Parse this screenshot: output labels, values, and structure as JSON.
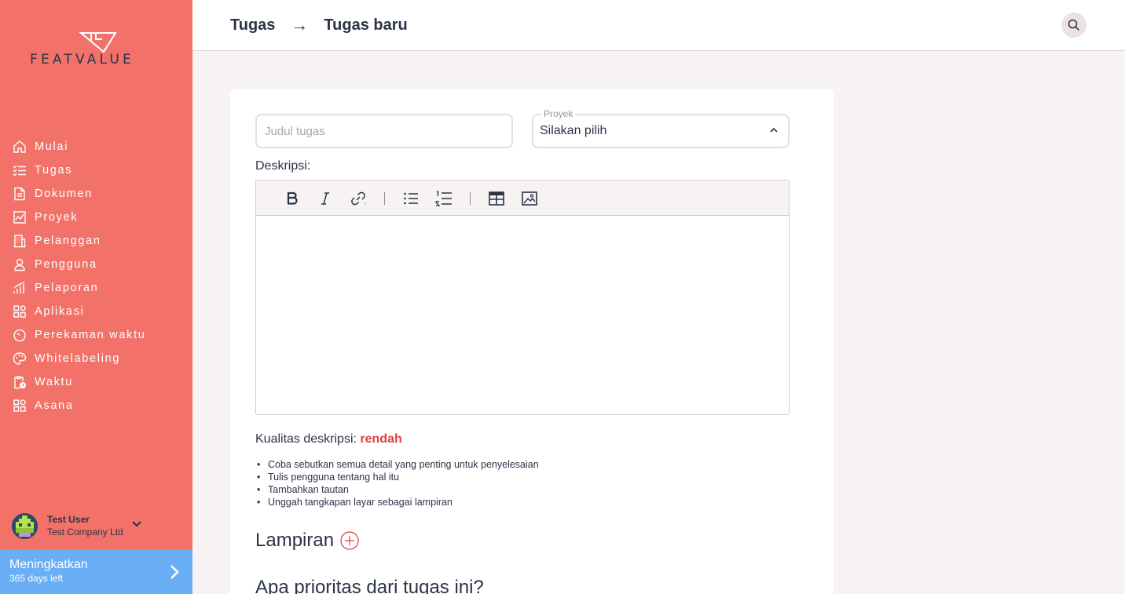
{
  "brand": {
    "logo_text": "FEATVALUE"
  },
  "colors": {
    "sidebar": "#f2726a",
    "upgrade": "#6aaef5",
    "danger": "#e23c3c",
    "text": "#2b3346"
  },
  "sidebar": {
    "items": [
      {
        "label": "Mulai",
        "icon": "home-icon"
      },
      {
        "label": "Tugas",
        "icon": "task-list-icon"
      },
      {
        "label": "Dokumen",
        "icon": "document-icon"
      },
      {
        "label": "Proyek",
        "icon": "project-chart-icon"
      },
      {
        "label": "Pelanggan",
        "icon": "building-icon"
      },
      {
        "label": "Pengguna",
        "icon": "user-icon"
      },
      {
        "label": "Pelaporan",
        "icon": "report-bars-icon"
      },
      {
        "label": "Aplikasi",
        "icon": "apps-icon"
      },
      {
        "label": "Perekaman waktu",
        "icon": "timer-icon"
      },
      {
        "label": "Whitelabeling",
        "icon": "palette-icon"
      },
      {
        "label": "Waktu",
        "icon": "clipboard-clock-icon"
      },
      {
        "label": "Asana",
        "icon": "apps-icon"
      }
    ],
    "user": {
      "name": "Test User",
      "company": "Test Company Ltd"
    },
    "upgrade": {
      "title": "Meningkatkan",
      "subtitle": "365 days left"
    }
  },
  "header": {
    "crumbs": [
      "Tugas",
      "Tugas baru"
    ],
    "separator": "→"
  },
  "form": {
    "title_placeholder": "Judul tugas",
    "project_label": "Proyek",
    "project_value": "Silakan pilih",
    "description_label": "Deskripsi:",
    "quality_label": "Kualitas deskripsi:",
    "quality_value": "rendah",
    "tips": [
      "Coba sebutkan semua detail yang penting untuk penyelesaian",
      "Tulis pengguna tentang hal itu",
      "Tambahkan tautan",
      "Unggah tangkapan layar sebagai lampiran"
    ],
    "attachments_title": "Lampiran",
    "priority_title": "Apa prioritas dari tugas ini?"
  }
}
